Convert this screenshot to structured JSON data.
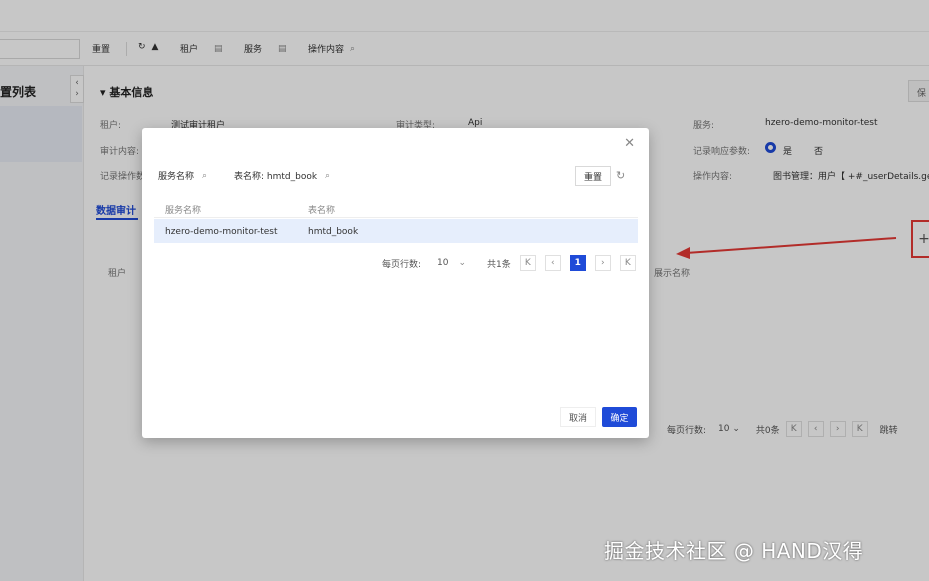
{
  "toolbar": {
    "reset": "重置",
    "tenant": "租户",
    "service": "服务",
    "operation_content": "操作内容"
  },
  "left": {
    "title": "置列表"
  },
  "section": {
    "title": "基本信息",
    "save": "保"
  },
  "form": {
    "tenant_label": "租户:",
    "tenant_value": "测试审计租户",
    "audit_type_label": "审计类型:",
    "audit_type_value": "Api",
    "service_label": "服务:",
    "service_value": "hzero-demo-monitor-test",
    "audit_content_label": "审计内容:",
    "record_resp_label": "记录响应参数:",
    "radio_yes": "是",
    "radio_no": "否",
    "record_op_label": "记录操作数",
    "op_content_label": "操作内容:",
    "op_content_value": "图书管理：用户【 +#_userDetails.getRea"
  },
  "tabs": {
    "data_audit": "数据审计"
  },
  "bg_table": {
    "col_tenant": "租户",
    "col_display": "展示名称"
  },
  "bg_pager": {
    "per_page_label": "每页行数:",
    "per_page_value": "10",
    "total": "共0条",
    "jump": "跳转"
  },
  "modal": {
    "search_service": "服务名称",
    "search_table": "表名称: hmtd_book",
    "reset": "重置",
    "columns": [
      "服务名称",
      "表名称"
    ],
    "rows": [
      {
        "service": "hzero-demo-monitor-test",
        "table": "hmtd_book"
      }
    ],
    "pager": {
      "per_page_label": "每页行数:",
      "per_page_value": "10",
      "total": "共1条",
      "current_page": "1"
    },
    "cancel": "取消",
    "ok": "确定"
  },
  "watermark": "掘金技术社区 @ HAND汉得",
  "colors": {
    "primary": "#1f4bd8",
    "annotation": "#e53935",
    "row_selected": "#e6eefc"
  }
}
